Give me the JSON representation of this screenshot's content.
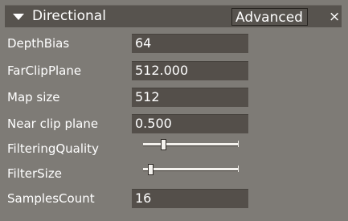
{
  "titlebar": {
    "title": "Directional",
    "advanced_label": "Advanced",
    "close_glyph": "×",
    "expand_icon": "triangle-down-icon"
  },
  "properties": {
    "depth_bias": {
      "label": "DepthBias",
      "value": "64"
    },
    "far_clip_plane": {
      "label": "FarClipPlane",
      "value": "512.000"
    },
    "map_size": {
      "label": "Map size",
      "value": "512"
    },
    "near_clip_plane": {
      "label": "Near clip plane",
      "value": "0.500"
    },
    "filtering_quality": {
      "label": "FilteringQuality",
      "level": 0.2
    },
    "filter_size": {
      "label": "FilterSize",
      "level": 0.05
    },
    "samples_count": {
      "label": "SamplesCount",
      "value": "16"
    }
  },
  "colors": {
    "panel_bg": "#7e7b76",
    "titlebar_bg": "#57534e",
    "field_bg": "#544f4a",
    "text": "#ffffff"
  }
}
